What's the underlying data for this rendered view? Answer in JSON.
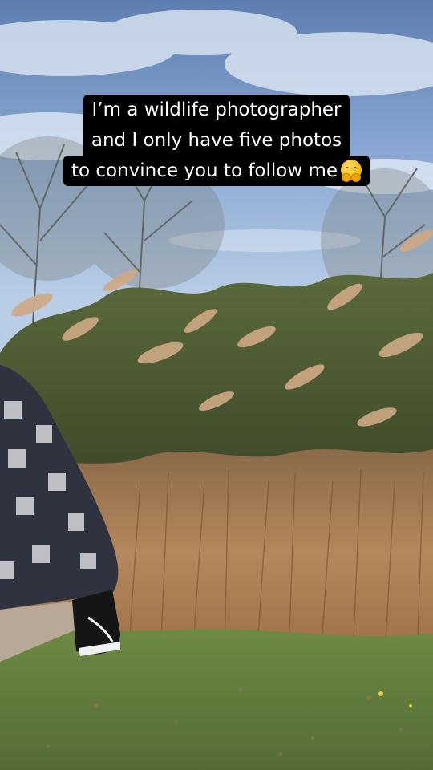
{
  "caption": {
    "line1": "I’m a wildlife photographer",
    "line2": "and I only have five photos",
    "line3": "to convince you to follow me",
    "emoji": "hugging-face-emoji"
  },
  "colors": {
    "sky_top": "#6f8fbf",
    "sky_bottom": "#a9c3e3",
    "reeds": "#b88a62",
    "grass": "#5f7a3a",
    "caption_bg": "#000000",
    "caption_text": "#ffffff"
  }
}
